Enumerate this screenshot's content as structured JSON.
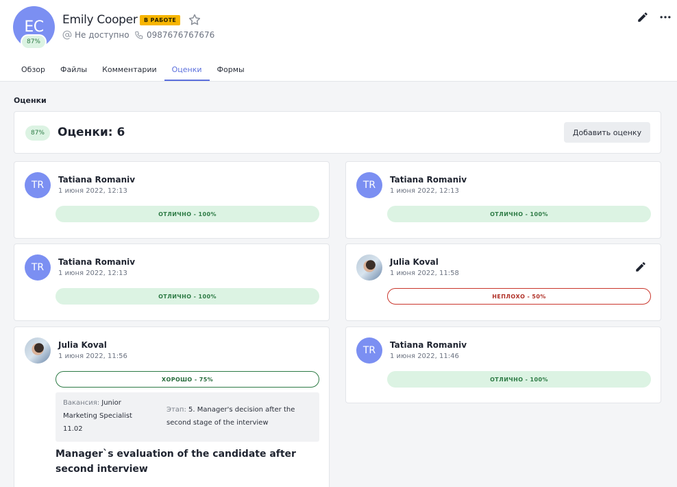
{
  "candidate": {
    "initials": "EC",
    "score": "87%",
    "name": "Emily Cooper",
    "status": "В РАБОТЕ",
    "email": "Не доступно",
    "phone": "0987676767676"
  },
  "tabs": [
    {
      "label": "Обзор"
    },
    {
      "label": "Файлы"
    },
    {
      "label": "Комментарии"
    },
    {
      "label": "Оценки",
      "active": true
    },
    {
      "label": "Формы"
    }
  ],
  "section": {
    "title": "Оценки"
  },
  "summary": {
    "score": "87%",
    "count_label": "Оценки: 6",
    "add_button": "Добавить оценку"
  },
  "evaluations": [
    {
      "initials": "TR",
      "author": "Tatiana Romaniv",
      "date": "1 июня 2022, 12:13",
      "grade": "ОТЛИЧНО - 100%",
      "grade_type": "excellent"
    },
    {
      "initials": "TR",
      "author": "Tatiana Romaniv",
      "date": "1 июня 2022, 12:13",
      "grade": "ОТЛИЧНО - 100%",
      "grade_type": "excellent"
    },
    {
      "initials": "TR",
      "author": "Tatiana Romaniv",
      "date": "1 июня 2022, 12:13",
      "grade": "ОТЛИЧНО - 100%",
      "grade_type": "excellent"
    },
    {
      "initials": "",
      "author": "Julia Koval",
      "date": "1 июня 2022, 11:58",
      "grade": "НЕПЛОХО - 50%",
      "grade_type": "fine"
    },
    {
      "initials": "",
      "author": "Julia Koval",
      "date": "1 июня 2022, 11:56",
      "grade": "ХОРОШО - 75%",
      "grade_type": "good",
      "vacancy_label": "Вакансия:",
      "vacancy": "Junior Marketing Specialist 11.02",
      "stage_label": "Этап:",
      "stage": "5. Manager's decision after the second stage of the interview",
      "review_title": "Manager`s evaluation of the candidate after second interview"
    },
    {
      "initials": "TR",
      "author": "Tatiana Romaniv",
      "date": "1 июня 2022, 11:46",
      "grade": "ОТЛИЧНО - 100%",
      "grade_type": "excellent"
    }
  ],
  "icons": {
    "star": "star-icon",
    "email": "at-icon",
    "phone": "phone-icon",
    "edit": "pencil-icon",
    "more": "more-horizontal-icon"
  },
  "colors": {
    "accent": "#5b6fdc",
    "avatar": "#7b8ff2",
    "status": "#f7b500",
    "excellent_bg": "#dcf3e3",
    "fine_border": "#c9352b",
    "good_border": "#2c7a44"
  }
}
